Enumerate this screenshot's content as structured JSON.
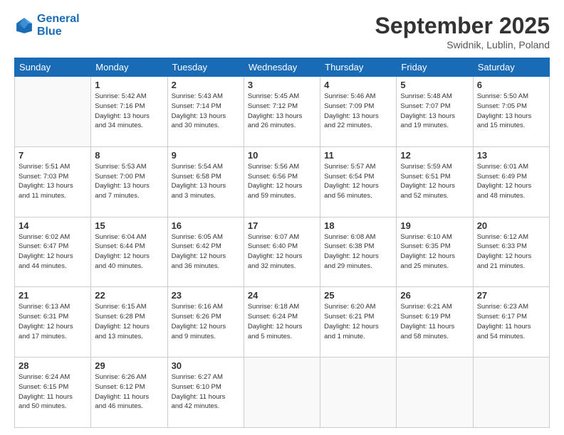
{
  "header": {
    "logo_line1": "General",
    "logo_line2": "Blue",
    "month": "September 2025",
    "location": "Swidnik, Lublin, Poland"
  },
  "weekdays": [
    "Sunday",
    "Monday",
    "Tuesday",
    "Wednesday",
    "Thursday",
    "Friday",
    "Saturday"
  ],
  "weeks": [
    [
      {
        "day": "",
        "info": ""
      },
      {
        "day": "1",
        "info": "Sunrise: 5:42 AM\nSunset: 7:16 PM\nDaylight: 13 hours\nand 34 minutes."
      },
      {
        "day": "2",
        "info": "Sunrise: 5:43 AM\nSunset: 7:14 PM\nDaylight: 13 hours\nand 30 minutes."
      },
      {
        "day": "3",
        "info": "Sunrise: 5:45 AM\nSunset: 7:12 PM\nDaylight: 13 hours\nand 26 minutes."
      },
      {
        "day": "4",
        "info": "Sunrise: 5:46 AM\nSunset: 7:09 PM\nDaylight: 13 hours\nand 22 minutes."
      },
      {
        "day": "5",
        "info": "Sunrise: 5:48 AM\nSunset: 7:07 PM\nDaylight: 13 hours\nand 19 minutes."
      },
      {
        "day": "6",
        "info": "Sunrise: 5:50 AM\nSunset: 7:05 PM\nDaylight: 13 hours\nand 15 minutes."
      }
    ],
    [
      {
        "day": "7",
        "info": "Sunrise: 5:51 AM\nSunset: 7:03 PM\nDaylight: 13 hours\nand 11 minutes."
      },
      {
        "day": "8",
        "info": "Sunrise: 5:53 AM\nSunset: 7:00 PM\nDaylight: 13 hours\nand 7 minutes."
      },
      {
        "day": "9",
        "info": "Sunrise: 5:54 AM\nSunset: 6:58 PM\nDaylight: 13 hours\nand 3 minutes."
      },
      {
        "day": "10",
        "info": "Sunrise: 5:56 AM\nSunset: 6:56 PM\nDaylight: 12 hours\nand 59 minutes."
      },
      {
        "day": "11",
        "info": "Sunrise: 5:57 AM\nSunset: 6:54 PM\nDaylight: 12 hours\nand 56 minutes."
      },
      {
        "day": "12",
        "info": "Sunrise: 5:59 AM\nSunset: 6:51 PM\nDaylight: 12 hours\nand 52 minutes."
      },
      {
        "day": "13",
        "info": "Sunrise: 6:01 AM\nSunset: 6:49 PM\nDaylight: 12 hours\nand 48 minutes."
      }
    ],
    [
      {
        "day": "14",
        "info": "Sunrise: 6:02 AM\nSunset: 6:47 PM\nDaylight: 12 hours\nand 44 minutes."
      },
      {
        "day": "15",
        "info": "Sunrise: 6:04 AM\nSunset: 6:44 PM\nDaylight: 12 hours\nand 40 minutes."
      },
      {
        "day": "16",
        "info": "Sunrise: 6:05 AM\nSunset: 6:42 PM\nDaylight: 12 hours\nand 36 minutes."
      },
      {
        "day": "17",
        "info": "Sunrise: 6:07 AM\nSunset: 6:40 PM\nDaylight: 12 hours\nand 32 minutes."
      },
      {
        "day": "18",
        "info": "Sunrise: 6:08 AM\nSunset: 6:38 PM\nDaylight: 12 hours\nand 29 minutes."
      },
      {
        "day": "19",
        "info": "Sunrise: 6:10 AM\nSunset: 6:35 PM\nDaylight: 12 hours\nand 25 minutes."
      },
      {
        "day": "20",
        "info": "Sunrise: 6:12 AM\nSunset: 6:33 PM\nDaylight: 12 hours\nand 21 minutes."
      }
    ],
    [
      {
        "day": "21",
        "info": "Sunrise: 6:13 AM\nSunset: 6:31 PM\nDaylight: 12 hours\nand 17 minutes."
      },
      {
        "day": "22",
        "info": "Sunrise: 6:15 AM\nSunset: 6:28 PM\nDaylight: 12 hours\nand 13 minutes."
      },
      {
        "day": "23",
        "info": "Sunrise: 6:16 AM\nSunset: 6:26 PM\nDaylight: 12 hours\nand 9 minutes."
      },
      {
        "day": "24",
        "info": "Sunrise: 6:18 AM\nSunset: 6:24 PM\nDaylight: 12 hours\nand 5 minutes."
      },
      {
        "day": "25",
        "info": "Sunrise: 6:20 AM\nSunset: 6:21 PM\nDaylight: 12 hours\nand 1 minute."
      },
      {
        "day": "26",
        "info": "Sunrise: 6:21 AM\nSunset: 6:19 PM\nDaylight: 11 hours\nand 58 minutes."
      },
      {
        "day": "27",
        "info": "Sunrise: 6:23 AM\nSunset: 6:17 PM\nDaylight: 11 hours\nand 54 minutes."
      }
    ],
    [
      {
        "day": "28",
        "info": "Sunrise: 6:24 AM\nSunset: 6:15 PM\nDaylight: 11 hours\nand 50 minutes."
      },
      {
        "day": "29",
        "info": "Sunrise: 6:26 AM\nSunset: 6:12 PM\nDaylight: 11 hours\nand 46 minutes."
      },
      {
        "day": "30",
        "info": "Sunrise: 6:27 AM\nSunset: 6:10 PM\nDaylight: 11 hours\nand 42 minutes."
      },
      {
        "day": "",
        "info": ""
      },
      {
        "day": "",
        "info": ""
      },
      {
        "day": "",
        "info": ""
      },
      {
        "day": "",
        "info": ""
      }
    ]
  ]
}
